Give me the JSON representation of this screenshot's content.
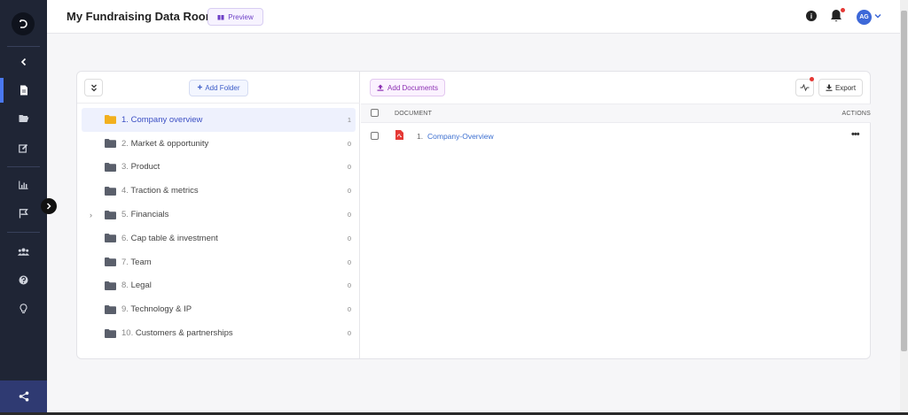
{
  "app": {
    "title": "My Fundraising Data Room",
    "preview_label": "Preview",
    "avatar_initials": "AG",
    "info_glyph": "i"
  },
  "sidebar": {
    "items": [
      {
        "name": "back",
        "icon": "chevron-left-icon"
      },
      {
        "name": "documents",
        "icon": "document-icon",
        "active": true
      },
      {
        "name": "folders",
        "icon": "folder-open-icon"
      },
      {
        "name": "edit",
        "icon": "edit-icon"
      },
      {
        "name": "analytics",
        "icon": "bar-chart-icon"
      },
      {
        "name": "flag",
        "icon": "flag-icon"
      },
      {
        "name": "team",
        "icon": "users-icon"
      },
      {
        "name": "help",
        "icon": "help-icon"
      },
      {
        "name": "ideas",
        "icon": "lightbulb-icon"
      }
    ],
    "bottom_icon": "share-icon"
  },
  "folders_panel": {
    "add_folder_label": "Add Folder",
    "folders": [
      {
        "num": "1.",
        "label": "Company overview",
        "count": "1",
        "selected": true,
        "caret": ""
      },
      {
        "num": "2.",
        "label": "Market & opportunity",
        "count": "0",
        "caret": ""
      },
      {
        "num": "3.",
        "label": "Product",
        "count": "0",
        "caret": ""
      },
      {
        "num": "4.",
        "label": "Traction & metrics",
        "count": "0",
        "caret": ""
      },
      {
        "num": "5.",
        "label": "Financials",
        "count": "0",
        "caret": "›"
      },
      {
        "num": "6.",
        "label": "Cap table & investment",
        "count": "0",
        "caret": ""
      },
      {
        "num": "7.",
        "label": "Team",
        "count": "0",
        "caret": ""
      },
      {
        "num": "8.",
        "label": "Legal",
        "count": "0",
        "caret": ""
      },
      {
        "num": "9.",
        "label": "Technology & IP",
        "count": "0",
        "caret": ""
      },
      {
        "num": "10.",
        "label": "Customers & partnerships",
        "count": "0",
        "caret": ""
      }
    ]
  },
  "documents_panel": {
    "add_documents_label": "Add Documents",
    "export_label": "Export",
    "columns": {
      "document": "DOCUMENT",
      "actions": "ACTIONS"
    },
    "rows": [
      {
        "num": "1.",
        "name": "Company-Overview",
        "type": "pdf",
        "actions": "•••"
      }
    ]
  },
  "colors": {
    "sidebar_bg": "#1f2535",
    "accent_blue": "#3b4fc4",
    "folder_selected": "#f2b01e",
    "folder_default": "#5a5f6b",
    "pdf_red": "#e53935",
    "preview_purple": "#6d3fc7"
  }
}
